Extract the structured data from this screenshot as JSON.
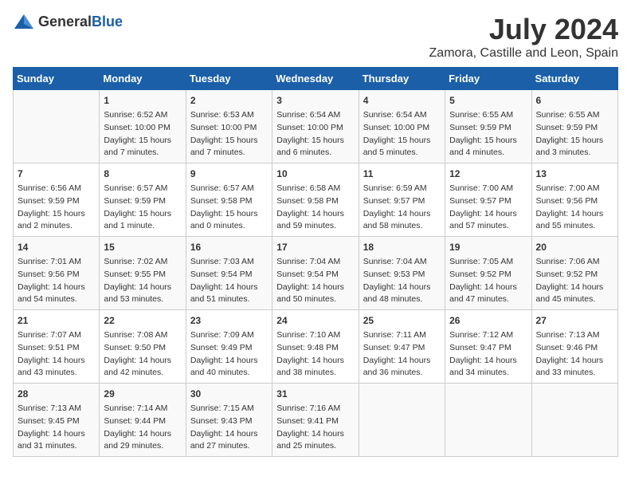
{
  "logo": {
    "general": "General",
    "blue": "Blue"
  },
  "title": "July 2024",
  "subtitle": "Zamora, Castille and Leon, Spain",
  "header": {
    "days": [
      "Sunday",
      "Monday",
      "Tuesday",
      "Wednesday",
      "Thursday",
      "Friday",
      "Saturday"
    ]
  },
  "weeks": [
    {
      "cells": [
        {
          "day": "",
          "content": ""
        },
        {
          "day": "1",
          "content": "Sunrise: 6:52 AM\nSunset: 10:00 PM\nDaylight: 15 hours\nand 7 minutes."
        },
        {
          "day": "2",
          "content": "Sunrise: 6:53 AM\nSunset: 10:00 PM\nDaylight: 15 hours\nand 7 minutes."
        },
        {
          "day": "3",
          "content": "Sunrise: 6:54 AM\nSunset: 10:00 PM\nDaylight: 15 hours\nand 6 minutes."
        },
        {
          "day": "4",
          "content": "Sunrise: 6:54 AM\nSunset: 10:00 PM\nDaylight: 15 hours\nand 5 minutes."
        },
        {
          "day": "5",
          "content": "Sunrise: 6:55 AM\nSunset: 9:59 PM\nDaylight: 15 hours\nand 4 minutes."
        },
        {
          "day": "6",
          "content": "Sunrise: 6:55 AM\nSunset: 9:59 PM\nDaylight: 15 hours\nand 3 minutes."
        }
      ]
    },
    {
      "cells": [
        {
          "day": "7",
          "content": "Sunrise: 6:56 AM\nSunset: 9:59 PM\nDaylight: 15 hours\nand 2 minutes."
        },
        {
          "day": "8",
          "content": "Sunrise: 6:57 AM\nSunset: 9:59 PM\nDaylight: 15 hours\nand 1 minute."
        },
        {
          "day": "9",
          "content": "Sunrise: 6:57 AM\nSunset: 9:58 PM\nDaylight: 15 hours\nand 0 minutes."
        },
        {
          "day": "10",
          "content": "Sunrise: 6:58 AM\nSunset: 9:58 PM\nDaylight: 14 hours\nand 59 minutes."
        },
        {
          "day": "11",
          "content": "Sunrise: 6:59 AM\nSunset: 9:57 PM\nDaylight: 14 hours\nand 58 minutes."
        },
        {
          "day": "12",
          "content": "Sunrise: 7:00 AM\nSunset: 9:57 PM\nDaylight: 14 hours\nand 57 minutes."
        },
        {
          "day": "13",
          "content": "Sunrise: 7:00 AM\nSunset: 9:56 PM\nDaylight: 14 hours\nand 55 minutes."
        }
      ]
    },
    {
      "cells": [
        {
          "day": "14",
          "content": "Sunrise: 7:01 AM\nSunset: 9:56 PM\nDaylight: 14 hours\nand 54 minutes."
        },
        {
          "day": "15",
          "content": "Sunrise: 7:02 AM\nSunset: 9:55 PM\nDaylight: 14 hours\nand 53 minutes."
        },
        {
          "day": "16",
          "content": "Sunrise: 7:03 AM\nSunset: 9:54 PM\nDaylight: 14 hours\nand 51 minutes."
        },
        {
          "day": "17",
          "content": "Sunrise: 7:04 AM\nSunset: 9:54 PM\nDaylight: 14 hours\nand 50 minutes."
        },
        {
          "day": "18",
          "content": "Sunrise: 7:04 AM\nSunset: 9:53 PM\nDaylight: 14 hours\nand 48 minutes."
        },
        {
          "day": "19",
          "content": "Sunrise: 7:05 AM\nSunset: 9:52 PM\nDaylight: 14 hours\nand 47 minutes."
        },
        {
          "day": "20",
          "content": "Sunrise: 7:06 AM\nSunset: 9:52 PM\nDaylight: 14 hours\nand 45 minutes."
        }
      ]
    },
    {
      "cells": [
        {
          "day": "21",
          "content": "Sunrise: 7:07 AM\nSunset: 9:51 PM\nDaylight: 14 hours\nand 43 minutes."
        },
        {
          "day": "22",
          "content": "Sunrise: 7:08 AM\nSunset: 9:50 PM\nDaylight: 14 hours\nand 42 minutes."
        },
        {
          "day": "23",
          "content": "Sunrise: 7:09 AM\nSunset: 9:49 PM\nDaylight: 14 hours\nand 40 minutes."
        },
        {
          "day": "24",
          "content": "Sunrise: 7:10 AM\nSunset: 9:48 PM\nDaylight: 14 hours\nand 38 minutes."
        },
        {
          "day": "25",
          "content": "Sunrise: 7:11 AM\nSunset: 9:47 PM\nDaylight: 14 hours\nand 36 minutes."
        },
        {
          "day": "26",
          "content": "Sunrise: 7:12 AM\nSunset: 9:47 PM\nDaylight: 14 hours\nand 34 minutes."
        },
        {
          "day": "27",
          "content": "Sunrise: 7:13 AM\nSunset: 9:46 PM\nDaylight: 14 hours\nand 33 minutes."
        }
      ]
    },
    {
      "cells": [
        {
          "day": "28",
          "content": "Sunrise: 7:13 AM\nSunset: 9:45 PM\nDaylight: 14 hours\nand 31 minutes."
        },
        {
          "day": "29",
          "content": "Sunrise: 7:14 AM\nSunset: 9:44 PM\nDaylight: 14 hours\nand 29 minutes."
        },
        {
          "day": "30",
          "content": "Sunrise: 7:15 AM\nSunset: 9:43 PM\nDaylight: 14 hours\nand 27 minutes."
        },
        {
          "day": "31",
          "content": "Sunrise: 7:16 AM\nSunset: 9:41 PM\nDaylight: 14 hours\nand 25 minutes."
        },
        {
          "day": "",
          "content": ""
        },
        {
          "day": "",
          "content": ""
        },
        {
          "day": "",
          "content": ""
        }
      ]
    }
  ]
}
